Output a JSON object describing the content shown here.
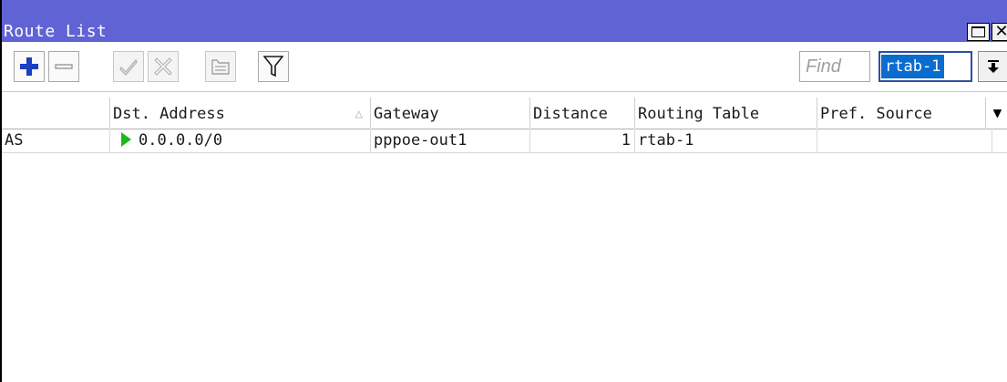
{
  "window": {
    "title": "Route List"
  },
  "toolbar": {
    "buttons": [
      {
        "name": "add-button",
        "icon": "plus-icon",
        "enabled": true
      },
      {
        "name": "remove-button",
        "icon": "minus-icon",
        "enabled": true
      },
      {
        "name": "enable-button",
        "icon": "check-icon",
        "enabled": false
      },
      {
        "name": "disable-button",
        "icon": "cross-icon",
        "enabled": false
      },
      {
        "name": "comment-button",
        "icon": "comment-icon",
        "enabled": false
      },
      {
        "name": "filter-button",
        "icon": "filter-icon",
        "enabled": true
      }
    ],
    "find_placeholder": "Find",
    "routing_table_value": "rtab-1"
  },
  "grid": {
    "columns": [
      {
        "key": "flags",
        "label": ""
      },
      {
        "key": "dst_address",
        "label": "Dst. Address",
        "sorted": "asc"
      },
      {
        "key": "gateway",
        "label": "Gateway"
      },
      {
        "key": "distance",
        "label": "Distance"
      },
      {
        "key": "routing_table",
        "label": "Routing Table"
      },
      {
        "key": "pref_source",
        "label": "Pref. Source"
      }
    ],
    "rows": [
      {
        "flags": "AS",
        "active": true,
        "dst_address": "0.0.0.0/0",
        "gateway": "pppoe-out1",
        "distance": "1",
        "routing_table": "rtab-1",
        "pref_source": ""
      }
    ]
  },
  "colors": {
    "titlebar": "#6063d4",
    "plus_icon": "#1a3fbf",
    "active_arrow": "#1eb81e",
    "selection": "#0a6ccf"
  }
}
